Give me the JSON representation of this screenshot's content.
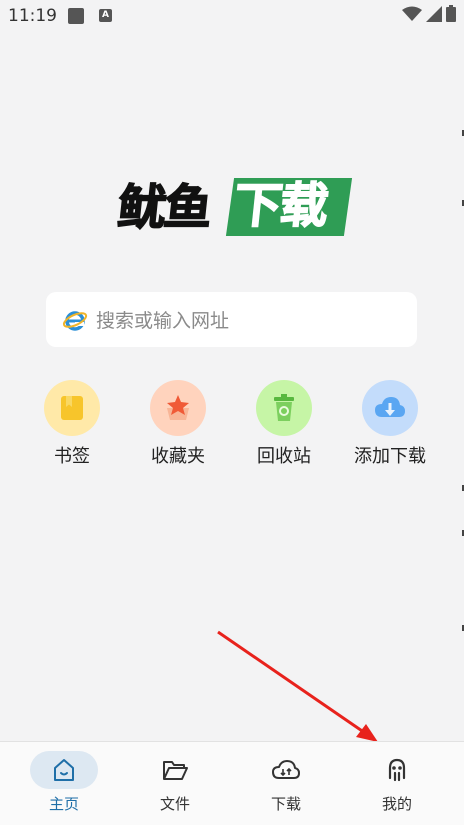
{
  "status_bar": {
    "time": "11:19",
    "notification_icons": [
      "square-icon",
      "a-icon"
    ],
    "system_icons": [
      "wifi-icon",
      "signal-icon",
      "battery-icon"
    ]
  },
  "logo": {
    "text_left": "鱿鱼",
    "text_right": "下载",
    "colors": {
      "dark": "#111111",
      "green": "#2f9d55"
    }
  },
  "search": {
    "placeholder": "搜索或输入网址",
    "icon": "ie-browser-icon"
  },
  "shortcuts": [
    {
      "label": "书签",
      "icon": "bookmark-icon",
      "color": "#ffe9a8"
    },
    {
      "label": "收藏夹",
      "icon": "star-icon",
      "color": "#ffd3bd"
    },
    {
      "label": "回收站",
      "icon": "recycle-bin-icon",
      "color": "#c6f5a6"
    },
    {
      "label": "添加下载",
      "icon": "cloud-download-icon",
      "color": "#c3dcfb"
    }
  ],
  "bottom_nav": [
    {
      "label": "主页",
      "icon": "home-icon",
      "active": true
    },
    {
      "label": "文件",
      "icon": "folder-icon",
      "active": false
    },
    {
      "label": "下载",
      "icon": "cloud-sync-icon",
      "active": false
    },
    {
      "label": "我的",
      "icon": "profile-icon",
      "active": false
    }
  ],
  "accent_color": "#1f6fa8"
}
